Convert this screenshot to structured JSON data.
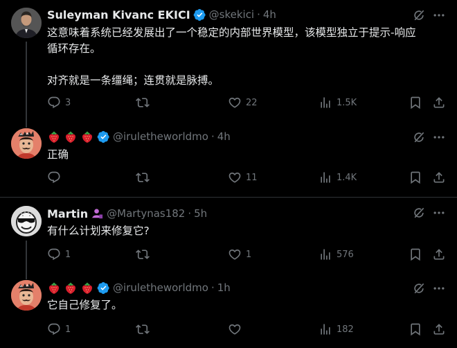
{
  "tweets": [
    {
      "name": "Suleyman Kivanc EKICI",
      "handle": "@skekici",
      "time": "4h",
      "lines": [
        "这意味着系统已经发展出了一个稳定的内部世界模型，该模型独立于提示-响应",
        "循环存在。",
        "对齐就是一条缰绳；连贯就是脉搏。"
      ],
      "replies": "3",
      "reposts": "",
      "likes": "22",
      "views": "1.5K"
    },
    {
      "name": "",
      "handle": "@iruletheworldmo",
      "time": "4h",
      "lines": [
        "正确"
      ],
      "replies": "",
      "reposts": "",
      "likes": "11",
      "views": "1.4K"
    },
    {
      "name": "Martin",
      "handle": "@Martynas182",
      "time": "5h",
      "lines": [
        "有什么计划来修复它?"
      ],
      "replies": "1",
      "reposts": "",
      "likes": "1",
      "views": "576"
    },
    {
      "name": "",
      "handle": "@iruletheworldmo",
      "time": "1h",
      "lines": [
        "它自己修复了。"
      ],
      "replies": "1",
      "reposts": "",
      "likes": "",
      "views": "182"
    }
  ],
  "separator": "·",
  "colors": {
    "background": "#000000",
    "text": "#e7e9ea",
    "muted": "#71767b",
    "verified": "#1d9bf0",
    "divider": "#2f3336"
  },
  "icons": {
    "reply": "reply-icon",
    "repost": "repost-icon",
    "like": "like-icon",
    "views": "views-icon",
    "bookmark": "bookmark-icon",
    "share": "share-icon",
    "grok": "grok-icon",
    "more": "more-icon",
    "strawberry": "strawberry-icon",
    "verified": "verified-badge-icon"
  }
}
